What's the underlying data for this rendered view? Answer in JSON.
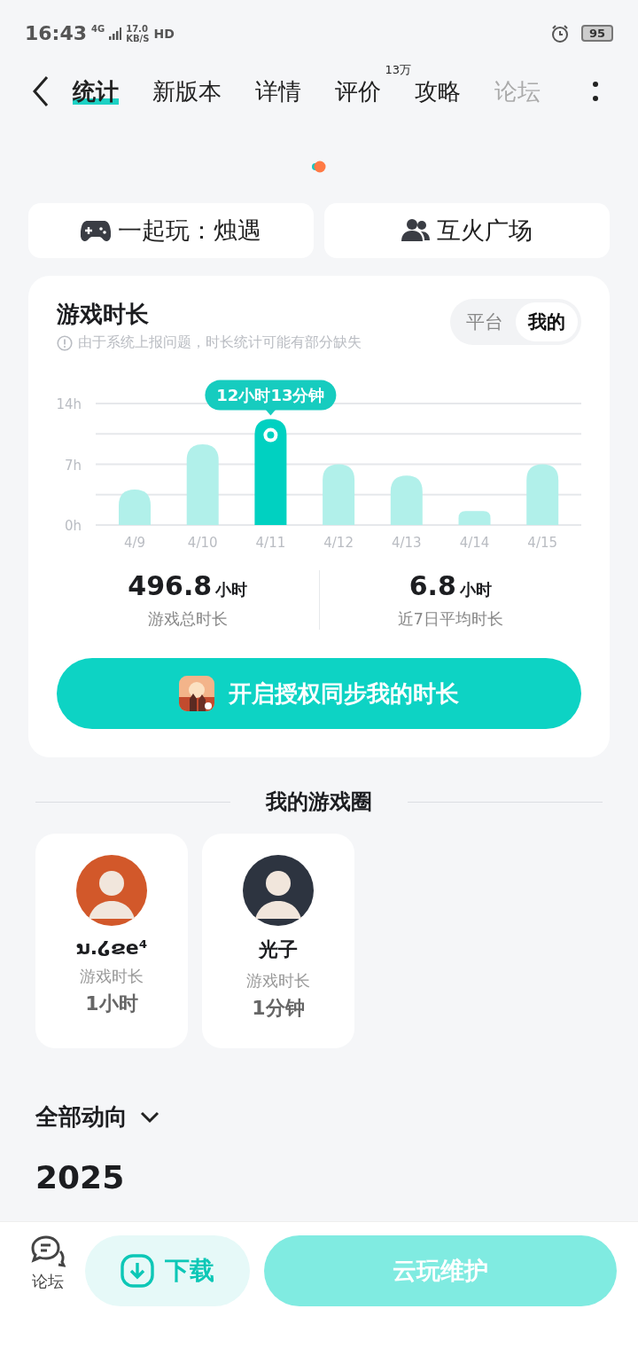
{
  "status_bar": {
    "time": "16:43",
    "network": "4G",
    "speed": "17.0",
    "speed_unit": "KB/S",
    "hd": "HD",
    "battery": "95"
  },
  "tabs": [
    {
      "label": "统计",
      "selected": true
    },
    {
      "label": "新版本",
      "selected": false
    },
    {
      "label": "详情",
      "selected": false
    },
    {
      "label": "评价",
      "selected": false,
      "badge": "13万"
    },
    {
      "label": "攻略",
      "selected": false
    },
    {
      "label": "论坛",
      "selected": false
    }
  ],
  "actions": [
    {
      "kind": "gamepad",
      "label": "一起玩：烛遇"
    },
    {
      "kind": "people",
      "label": "互火广场"
    }
  ],
  "playtime": {
    "title": "游戏时长",
    "notice": "由于系统上报问题，时长统计可能有部分缺失",
    "toggle": [
      {
        "label": "平台",
        "selected": false
      },
      {
        "label": "我的",
        "selected": true
      }
    ],
    "chart_data": {
      "type": "bar",
      "categories": [
        "4/9",
        "4/10",
        "4/11",
        "4/12",
        "4/13",
        "4/14",
        "4/15"
      ],
      "series": [
        {
          "color": "#b1f0ea",
          "values": [
            4.1,
            9.3,
            null,
            7.0,
            5.7,
            1.6,
            7.0
          ]
        },
        {
          "color": "#00d1c1",
          "values": [
            null,
            null,
            12.2,
            null,
            null,
            null,
            null
          ]
        }
      ],
      "ylim": [
        0,
        14
      ],
      "yticks": [
        {
          "value": 0,
          "label": "0h"
        },
        {
          "value": 7,
          "label": "7h"
        },
        {
          "value": 14,
          "label": "14h"
        }
      ],
      "annotations": [
        "12小时13分钟"
      ]
    },
    "stats": [
      {
        "value": "496.8",
        "unit": "小时",
        "label": "游戏总时长"
      },
      {
        "value": "6.8",
        "unit": "小时",
        "label": "近7日平均时长"
      }
    ],
    "sync_button": "开启授权同步我的时长"
  },
  "game_circle": {
    "title": "我的游戏圈",
    "friends": [
      {
        "name": "ນ.໒ຂe⁴",
        "label": "游戏时长",
        "duration": "1小时",
        "color": "#d2582a"
      },
      {
        "name": "光子",
        "label": "游戏时长",
        "duration": "1分钟",
        "color": "#2d3440"
      }
    ]
  },
  "feed": {
    "filter": "全部动向",
    "year": "2025"
  },
  "bottom_bar": {
    "forum": "论坛",
    "download": "下载",
    "cloud": {
      "label": "云玩维护",
      "disabled": true
    }
  }
}
